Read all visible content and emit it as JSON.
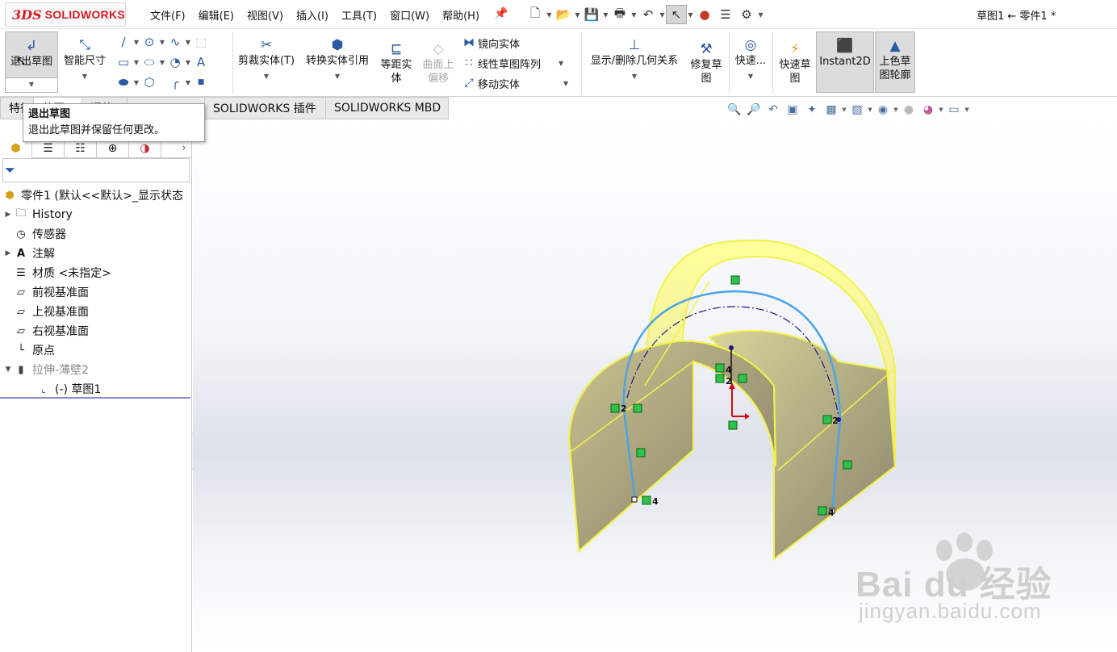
{
  "app": {
    "logo_mark": "3DS",
    "logo_text": "SOLIDWORKS",
    "document_title": "草图1 ← 零件1 *"
  },
  "menu": [
    "文件(F)",
    "编辑(E)",
    "视图(V)",
    "插入(I)",
    "工具(T)",
    "窗口(W)",
    "帮助(H)"
  ],
  "ribbon": {
    "exit_sketch": "退出草图",
    "smart_dimension": "智能尺寸",
    "trim_entities": "剪裁实体(T)",
    "convert_entities": "转换实体引用",
    "offset_entities_1": "等距实",
    "offset_entities_2": "体",
    "offset_on_surface_1": "曲面上",
    "offset_on_surface_2": "偏移",
    "mirror_entities": "镜向实体",
    "linear_pattern": "线性草图阵列",
    "move_entities": "移动实体",
    "display_relations": "显示/删除几何关系",
    "repair_sketch_1": "修复草",
    "repair_sketch_2": "图",
    "quick_snaps": "快速...",
    "rapid_sketch_1": "快速草",
    "rapid_sketch_2": "图",
    "instant2d": "Instant2D",
    "shaded_contours_1": "上色草",
    "shaded_contours_2": "图轮廓"
  },
  "tabs": [
    "特征",
    "草图",
    "评估",
    "",
    "SOLIDWORKS 插件",
    "SOLIDWORKS MBD"
  ],
  "tooltip": {
    "title": "退出草图",
    "description": "退出此草图并保留任何更改。"
  },
  "tree": {
    "root": "零件1  (默认<<默认>_显示状态",
    "items": [
      {
        "label": "History",
        "icon": "history-folder-icon",
        "expandable": true
      },
      {
        "label": "传感器",
        "icon": "sensor-icon",
        "expandable": false
      },
      {
        "label": "注解",
        "icon": "annotation-icon",
        "expandable": true
      },
      {
        "label": "材质 <未指定>",
        "icon": "material-icon",
        "expandable": false
      },
      {
        "label": "前视基准面",
        "icon": "plane-icon",
        "expandable": false
      },
      {
        "label": "上视基准面",
        "icon": "plane-icon",
        "expandable": false
      },
      {
        "label": "右视基准面",
        "icon": "plane-icon",
        "expandable": false
      },
      {
        "label": "原点",
        "icon": "origin-icon",
        "expandable": false
      },
      {
        "label": "拉伸-薄壁2",
        "icon": "extrude-icon",
        "expandable": true,
        "suppressed": true
      },
      {
        "label": "(-) 草图1",
        "icon": "sketch-icon",
        "expandable": false
      }
    ]
  },
  "sketch_relations": [
    "2",
    "2",
    "4",
    "4",
    "2",
    "4",
    "2"
  ],
  "watermark": {
    "line1": "Bai du 经验",
    "line2": "jingyan.baidu.com"
  },
  "colors": {
    "accent": "#2c5aa0",
    "model_fill": "#8f8a72",
    "model_edge": "#f2f24a",
    "sketch_line": "#4aa3e8",
    "relation_icon": "#2fc24a"
  }
}
